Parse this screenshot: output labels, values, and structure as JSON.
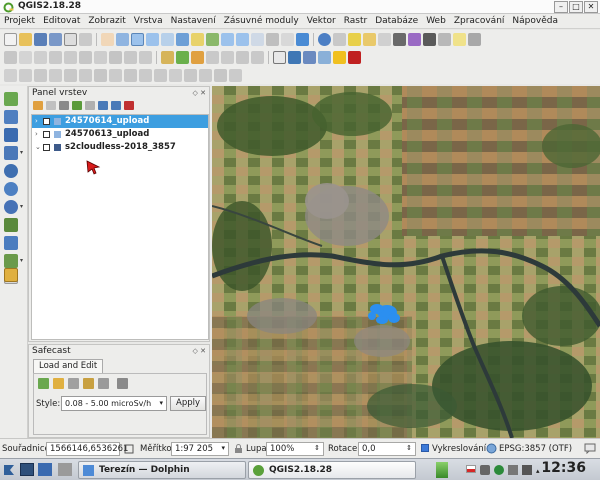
{
  "window": {
    "title": "QGIS2.18.28"
  },
  "menu": [
    "Projekt",
    "Editovat",
    "Zobrazit",
    "Vrstva",
    "Nastavení",
    "Zásuvné moduly",
    "Vektor",
    "Rastr",
    "Databáze",
    "Web",
    "Zpracování",
    "Nápověda"
  ],
  "layers_panel": {
    "title": "Panel vrstev",
    "layers": [
      {
        "name": "24570614_upload",
        "selected": true,
        "icon": "vector-layer-icon"
      },
      {
        "name": "24570613_upload",
        "selected": false,
        "icon": "vector-layer-icon"
      },
      {
        "name": "s2cloudless-2018_3857",
        "selected": false,
        "icon": "raster-layer-icon"
      }
    ]
  },
  "safecast": {
    "title": "Safecast",
    "tab": "Load and Edit",
    "style_label": "Style:",
    "style_value": "0.08 - 5.00 microSv/h",
    "apply_label": "Apply"
  },
  "statusbar": {
    "coord_label": "Souřadnice",
    "coord_value": "1566146,6536261",
    "scale_label": "Měřítko",
    "scale_value": "1:97 205",
    "magnifier_label": "Lupa",
    "magnifier_value": "100%",
    "rotation_label": "Rotace",
    "rotation_value": "0,0",
    "render_label": "Vykreslování",
    "crs_label": "EPSG:3857 (OTF)"
  },
  "taskbar": {
    "tasks": [
      {
        "label": "Terezín — Dolphin",
        "active": false
      },
      {
        "label": "QGIS2.18.28",
        "active": true
      }
    ],
    "clock": "12:36"
  },
  "colors": {
    "selection": "#3d9ee0",
    "safecast_points": "#2b8ff0",
    "river": "#2d3a3a"
  }
}
